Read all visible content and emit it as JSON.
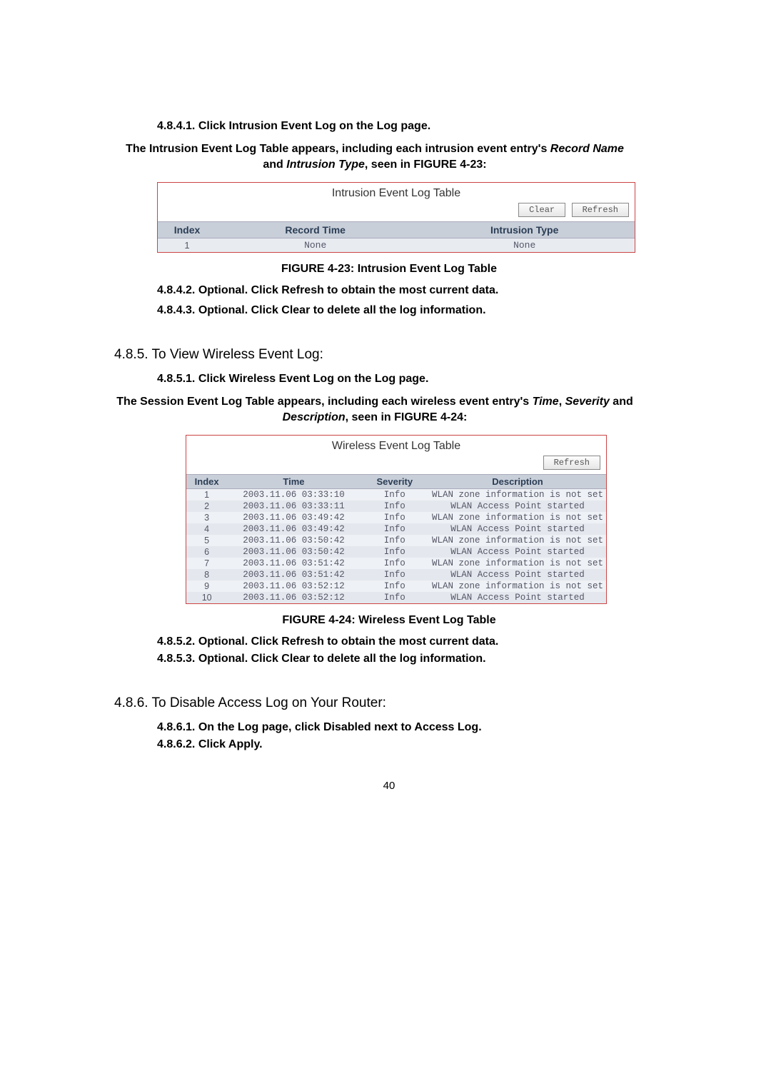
{
  "steps": {
    "s4841": "4.8.4.1. Click Intrusion Event Log on the Log page.",
    "s4842": "4.8.4.2. Optional. Click Refresh to obtain the most current data.",
    "s4843": "4.8.4.3. Optional. Click Clear to delete all the log information.",
    "s4851": "4.8.5.1. Click Wireless Event Log on the Log page.",
    "s4852": "4.8.5.2. Optional. Click Refresh to obtain the most current data.",
    "s4853": "4.8.5.3. Optional. Click Clear to delete all the log information.",
    "s4861": "4.8.6.1. On the Log page, click Disabled next to Access Log.",
    "s4862": "4.8.6.2. Click Apply."
  },
  "intro1": {
    "pre": "The Intrusion Event Log Table appears, including each intrusion event entry's ",
    "rn": "Record Name",
    "mid": " and ",
    "it": "Intrusion Type",
    "post": ", seen in FIGURE 4-23:"
  },
  "intro2": {
    "pre": "The Session Event Log Table appears, including each wireless event entry's ",
    "t": "Time",
    "c1": ", ",
    "s": "Severity",
    "mid": " and ",
    "d": "Description",
    "post": ", seen in FIGURE 4-24:"
  },
  "fig23": {
    "title": "Intrusion Event Log Table",
    "clear": "Clear",
    "refresh": "Refresh",
    "cols": {
      "index": "Index",
      "record": "Record Time",
      "type": "Intrusion Type"
    },
    "row": {
      "index": "1",
      "record": "None",
      "type": "None"
    },
    "caption": "FIGURE 4-23: Intrusion Event Log Table"
  },
  "sec485": "4.8.5. To View Wireless Event Log:",
  "fig24": {
    "title": "Wireless Event Log Table",
    "refresh": "Refresh",
    "cols": {
      "index": "Index",
      "time": "Time",
      "sev": "Severity",
      "desc": "Description"
    },
    "rows": [
      {
        "i": "1",
        "t": "2003.11.06 03:33:10",
        "s": "Info",
        "d": "WLAN zone information is not set"
      },
      {
        "i": "2",
        "t": "2003.11.06 03:33:11",
        "s": "Info",
        "d": "WLAN Access Point started"
      },
      {
        "i": "3",
        "t": "2003.11.06 03:49:42",
        "s": "Info",
        "d": "WLAN zone information is not set"
      },
      {
        "i": "4",
        "t": "2003.11.06 03:49:42",
        "s": "Info",
        "d": "WLAN Access Point started"
      },
      {
        "i": "5",
        "t": "2003.11.06 03:50:42",
        "s": "Info",
        "d": "WLAN zone information is not set"
      },
      {
        "i": "6",
        "t": "2003.11.06 03:50:42",
        "s": "Info",
        "d": "WLAN Access Point started"
      },
      {
        "i": "7",
        "t": "2003.11.06 03:51:42",
        "s": "Info",
        "d": "WLAN zone information is not set"
      },
      {
        "i": "8",
        "t": "2003.11.06 03:51:42",
        "s": "Info",
        "d": "WLAN Access Point started"
      },
      {
        "i": "9",
        "t": "2003.11.06 03:52:12",
        "s": "Info",
        "d": "WLAN zone information is not set"
      },
      {
        "i": "10",
        "t": "2003.11.06 03:52:12",
        "s": "Info",
        "d": "WLAN Access Point started"
      }
    ],
    "caption": "FIGURE 4-24: Wireless Event Log Table"
  },
  "sec486": "4.8.6. To Disable Access Log on Your Router:",
  "pagenum": "40"
}
